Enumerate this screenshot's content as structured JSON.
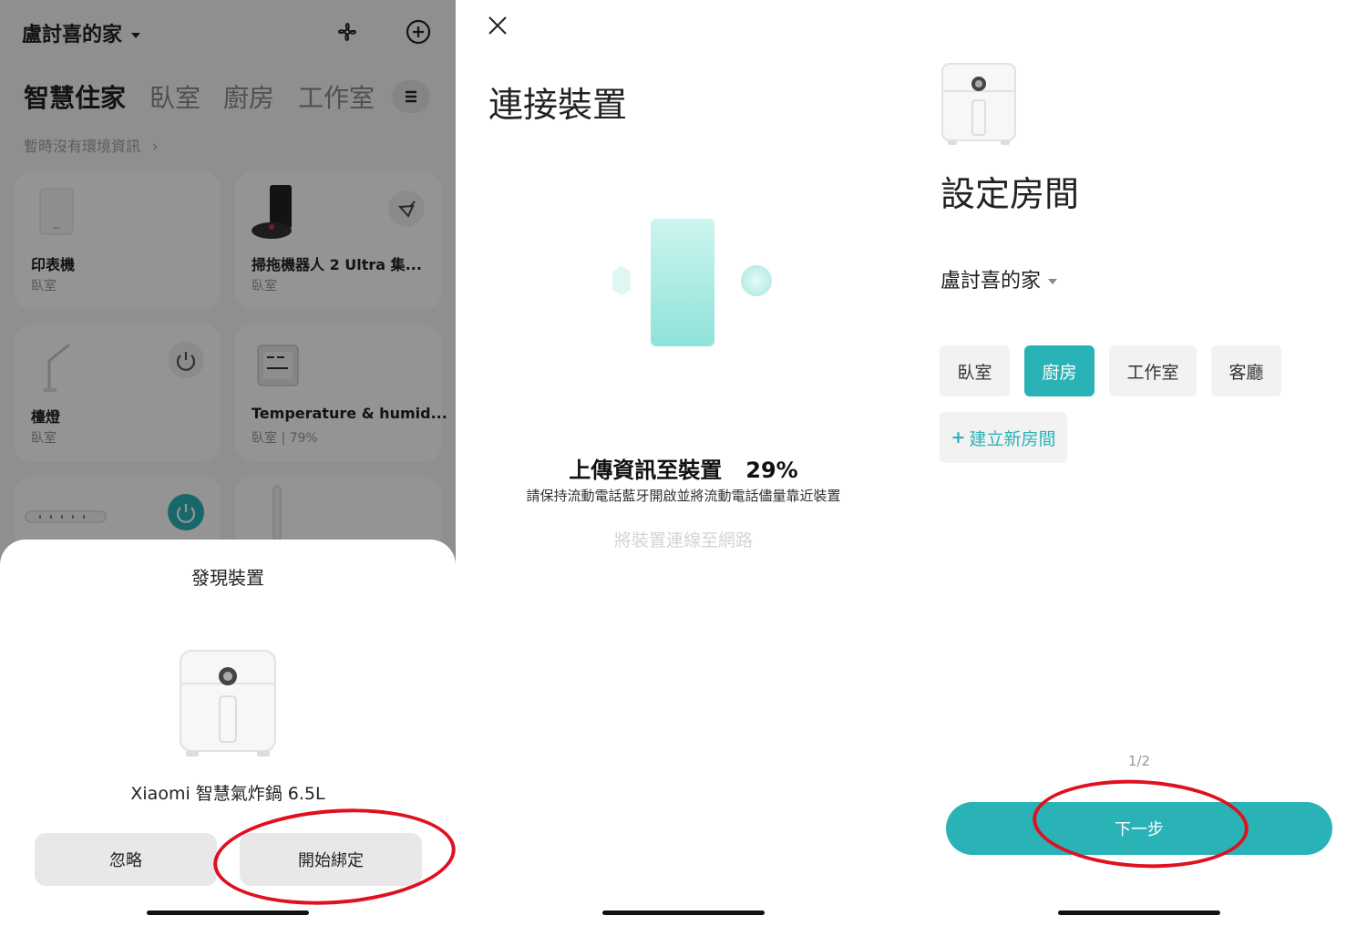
{
  "colors": {
    "accent": "#2ab3b6",
    "annotation": "#e0101e"
  },
  "home": {
    "title": "盧討喜的家",
    "icons": [
      "fan-icon",
      "plus-circle-icon"
    ],
    "tabs": [
      "智慧住家",
      "臥室",
      "廚房",
      "工作室"
    ],
    "env_text": "暫時沒有環境資訊",
    "devices": [
      {
        "name": "印表機",
        "room": "臥室"
      },
      {
        "name": "掃拖機器人 2 Ultra 集...",
        "room": "臥室"
      },
      {
        "name": "檯燈",
        "room": "臥室"
      },
      {
        "name": "Temperature & humid...",
        "room": "臥室 | 79%"
      }
    ]
  },
  "discovery_sheet": {
    "title": "發現裝置",
    "device_name": "Xiaomi 智慧氣炸鍋 6.5L",
    "ignore_label": "忽略",
    "bind_label": "開始綁定"
  },
  "connect": {
    "title": "連接裝置",
    "progress_label": "上傳資訊至裝置",
    "progress_percent": "29%",
    "progress_value": 0.29,
    "hint": "請保持流動電話藍牙開啟並將流動電話儘量靠近裝置",
    "next_step_label": "將裝置連線至網路"
  },
  "room_setup": {
    "title": "設定房間",
    "home_name": "盧討喜的家",
    "rooms": [
      "臥室",
      "廚房",
      "工作室",
      "客廳"
    ],
    "selected_room": "廚房",
    "new_room_label": "建立新房間",
    "page_indicator": "1/2",
    "next_label": "下一步"
  }
}
